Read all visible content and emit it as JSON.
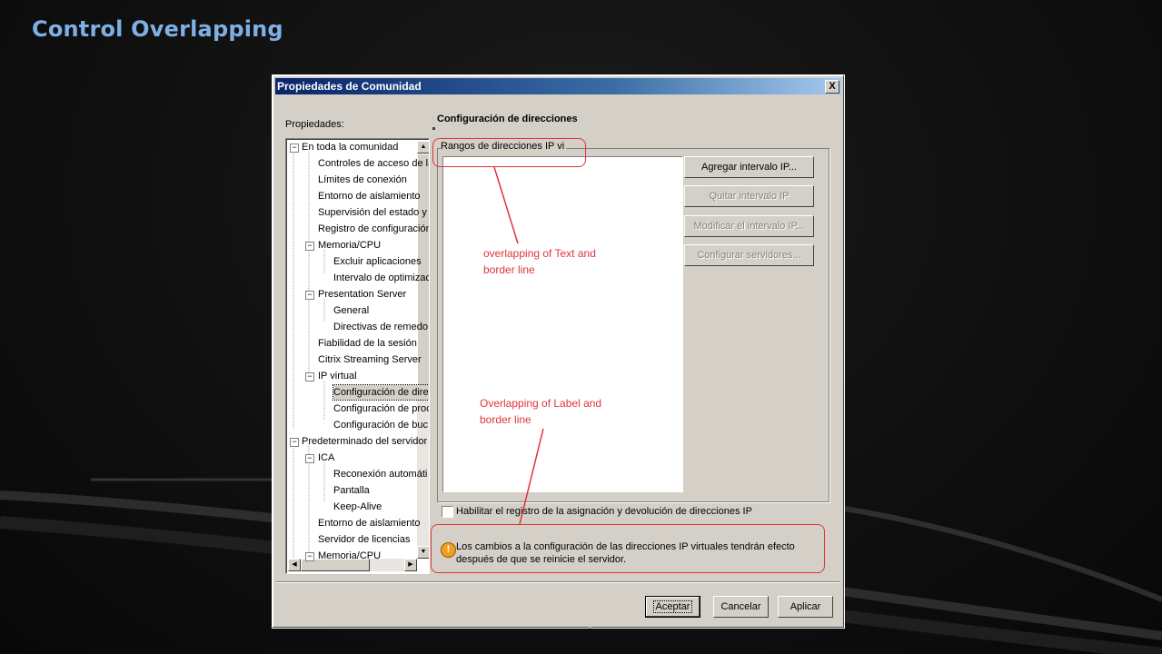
{
  "slide": {
    "title": "Control Overlapping"
  },
  "dialog": {
    "title": "Propiedades de Comunidad",
    "close_label": "X",
    "properties_label": "Propiedades:",
    "tree": [
      "En toda la comunidad",
      "Controles de acceso de la",
      "Límites de conexión",
      "Entorno de aislamiento",
      "Supervisión del estado y r",
      "Registro de configuración",
      "Memoria/CPU",
      "Excluir aplicaciones",
      "Intervalo de optimizac",
      "Presentation Server",
      "General",
      "Directivas de remedo",
      "Fiabilidad de la sesión",
      "Citrix Streaming Server",
      "IP virtual",
      "Configuración de dire",
      "Configuración de proc",
      "Configuración de buc",
      "Predeterminado del servidor",
      "ICA",
      "Reconexión automáti",
      "Pantalla",
      "Keep-Alive",
      "Entorno de aislamiento",
      "Servidor de licencias",
      "Memoria/CPU"
    ],
    "section_title": "Configuración de direcciones",
    "group_label": "Rangos de direcciones IP vi",
    "buttons": {
      "add": "Agregar intervalo IP...",
      "remove": "Quitar intervalo IP",
      "modify": "Modificar el intervalo IP...",
      "configure": "Configurar servidores..."
    },
    "checkbox_label": "Habilitar el registro de la asignación y devolución de direcciones IP",
    "checkbox_checked": false,
    "info_message": "Los cambios a la configuración de las direcciones IP virtuales tendrán efecto después de que se reinicie el servidor.",
    "footer": {
      "ok": "Aceptar",
      "cancel": "Cancelar",
      "apply": "Aplicar"
    }
  },
  "annotations": {
    "text_overlap": "overlapping of Text and border line",
    "label_overlap": "Overlapping of Label and border line",
    "color": "#e0343a"
  }
}
